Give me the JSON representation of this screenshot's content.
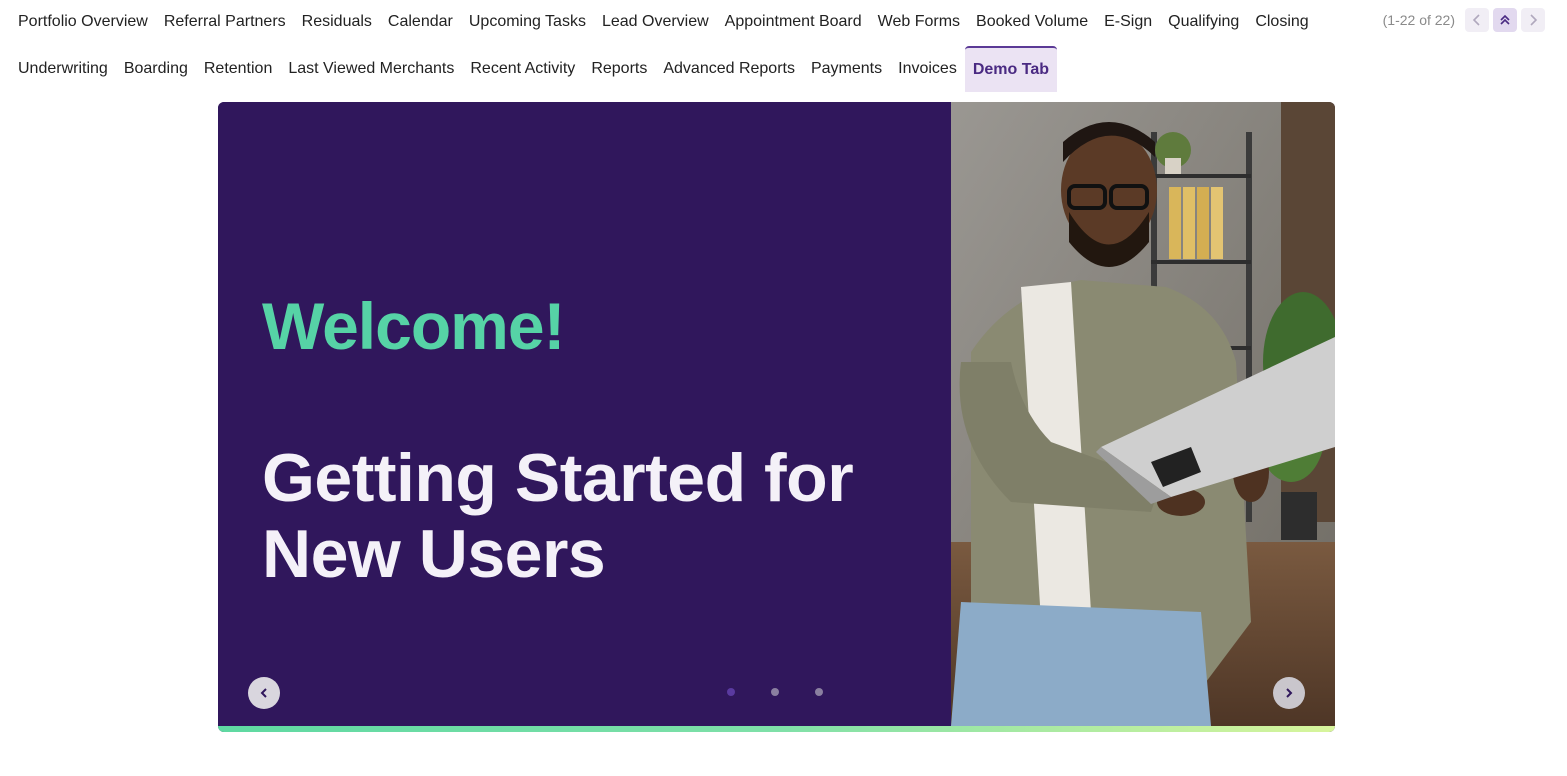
{
  "nav": {
    "row1": [
      "Portfolio Overview",
      "Referral Partners",
      "Residuals",
      "Calendar",
      "Upcoming Tasks",
      "Lead Overview",
      "Appointment Board",
      "Web Forms",
      "Booked Volume",
      "E-Sign",
      "Qualifying",
      "Closing"
    ],
    "row2": [
      "Underwriting",
      "Boarding",
      "Retention",
      "Last Viewed Merchants",
      "Recent Activity",
      "Reports",
      "Advanced Reports",
      "Payments",
      "Invoices",
      "Demo Tab"
    ],
    "active_tab": "Demo Tab"
  },
  "pager": {
    "range_text": "(1-22 of 22)"
  },
  "carousel": {
    "welcome": "Welcome!",
    "headline_line1": "Getting Started for",
    "headline_line2": "New Users",
    "slide_count": 3,
    "active_slide": 1,
    "prev_icon": "chevron-left-icon",
    "next_icon": "chevron-right-icon"
  },
  "colors": {
    "brand_purple": "#30175c",
    "accent_green": "#56d3a6",
    "active_tab_bg": "#ebe3f3",
    "active_tab_text": "#4a2a82"
  }
}
